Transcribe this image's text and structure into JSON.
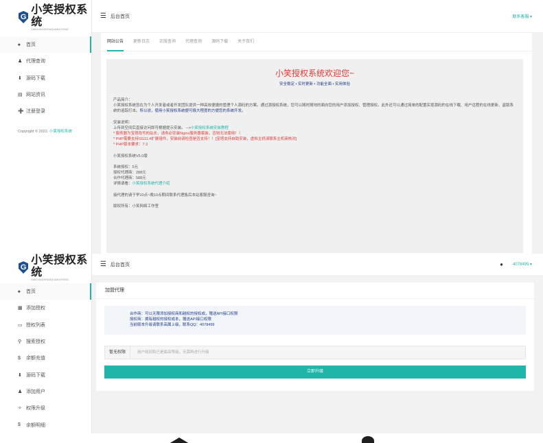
{
  "shot1": {
    "logo_title": "小笑授权系统",
    "logo_sub": "XIAOXIAOSHOUQUANXITONG",
    "header_title": "后台首页",
    "header_right": "联系客服 ▾",
    "nav": [
      {
        "icon": "home-icon",
        "glyph": "♠",
        "label": "首页"
      },
      {
        "icon": "user-icon",
        "glyph": "♟",
        "label": "代理查询"
      },
      {
        "icon": "download-icon",
        "glyph": "⬇",
        "label": "源码下载"
      },
      {
        "icon": "news-icon",
        "glyph": "▤",
        "label": "网站资讯"
      },
      {
        "icon": "register-icon",
        "glyph": "➕",
        "label": "注册登录"
      }
    ],
    "copyright_text": "Copyright © 2022.",
    "copyright_link": "小笑授权系统",
    "tabs": [
      "网站公告",
      "更新日志",
      "正版查询",
      "代理查询",
      "源码下载",
      "关于我们"
    ],
    "welcome": "小笑授权系统欢迎您~",
    "tagline": "安全稳定 • 实时更新 • 功能全面 • 实用体验",
    "intro_title": "产品简介：",
    "intro_body": "小笑授权系统旨在为个人开发者或者开发团队提供一种高效便捷的管理个人源码的方案。通过源授权系统，您可以随时随地的面向您的用户添加授权、管理授权。此外还可以通过简单的配置实现源码的在线下载、用户远程的在线更新、盗版系统的追踪打击。",
    "intro_link": "所以说，使用小笑授权系统便可极大程度的方便您的系统开发。",
    "install_title": "安装说明：",
    "install_line1": "上传到空间后直接访问即可根据提示安装。 -->",
    "install_link": "小笑授权系统安装教程",
    "install_red1": "* 服务器为宝塔改写的站长，请务必安装Nginx服务器套装，否则无法使用！！",
    "install_red2": "* PHP需要支持SG11.4扩展组件，安装前请检查是否支持！！[宝塔支持自助安装，虚拟主机请联系主机商核对]",
    "install_red3": "* PHP版本要求：7.3",
    "version": "小笑授权系统V5.0版",
    "price1": "系统授权：5元",
    "price2": "授权代理商：288元",
    "price3": "合作代理商：588元",
    "price4_label": "详情请看：",
    "price4_link": "小笑授权系统代理介绍",
    "service_note": "接代理的请于早10点~晚10点期间联系代理售后本站客服咨询~",
    "owner": "版权所有：小笑网络工作室"
  },
  "shot2": {
    "logo_title": "小笑授权系统",
    "logo_sub": "XIAOXIAOSHOUQUANXITONG",
    "header_title": "后台首页",
    "header_user": "4078499 ▾",
    "nav": [
      {
        "icon": "home-icon",
        "glyph": "♠",
        "label": "首页"
      },
      {
        "icon": "add-auth-icon",
        "glyph": "▦",
        "label": "添加授权"
      },
      {
        "icon": "list-icon",
        "glyph": "▭",
        "label": "授权列表"
      },
      {
        "icon": "search-icon",
        "glyph": "⚲",
        "label": "搜索授权"
      },
      {
        "icon": "dollar-icon",
        "glyph": "$",
        "label": "余额充值"
      },
      {
        "icon": "download-icon",
        "glyph": "⬇",
        "label": "源码下载"
      },
      {
        "icon": "add-user-icon",
        "glyph": "♟",
        "label": "添加用户"
      },
      {
        "icon": "upgrade-icon",
        "glyph": "✧",
        "label": "权限升级"
      },
      {
        "icon": "detail-icon",
        "glyph": "$",
        "label": "余额明细"
      }
    ],
    "card_title": "加盟代理",
    "info1": "合作商：可以无限添加授权商和越权的授权成，赠送API接口权限",
    "info2": "授权商：拥有越权的授权成本，赠送API接口权限",
    "info3": "当前版本升级请联系高属上级，联系QQ：4078499",
    "field_label": "暂无权限",
    "field_placeholder": "用户组别和已是最高等级，无需再进行升级",
    "upgrade_button": "立即升级"
  },
  "colors": {
    "accent": "#1fb5a8",
    "warning": "#e53935",
    "link_blue": "#1e3a8a",
    "logo_blue": "#1e4f92"
  }
}
